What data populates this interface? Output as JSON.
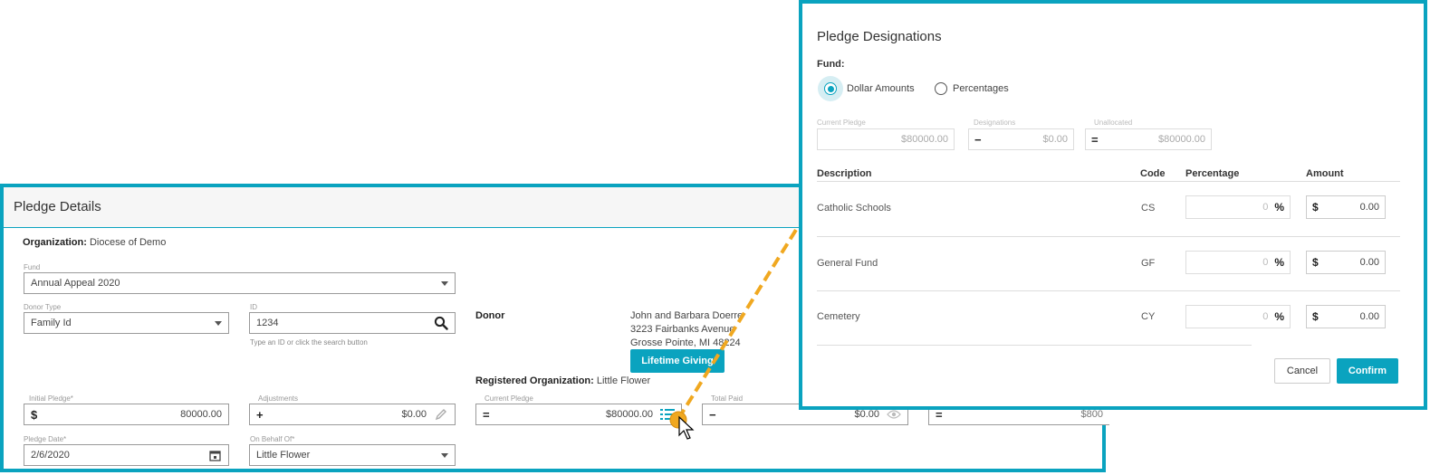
{
  "details": {
    "title": "Pledge Details",
    "organization_label": "Organization:",
    "organization_value": "Diocese of Demo",
    "fund": {
      "label": "Fund",
      "value": "Annual Appeal 2020"
    },
    "donor_type": {
      "label": "Donor Type",
      "value": "Family Id"
    },
    "id_field": {
      "label": "ID",
      "value": "1234",
      "hint": "Type an ID or click the search button"
    },
    "donor": {
      "label": "Donor",
      "name": "John and Barbara Doerre",
      "address1": "3223 Fairbanks Avenue",
      "address2": "Grosse Pointe, MI 48224",
      "lifetime_button": "Lifetime Giving"
    },
    "registered_org_label": "Registered Organization:",
    "registered_org_value": "Little Flower",
    "initial_pledge": {
      "label": "Initial Pledge*",
      "prefix": "$",
      "value": "80000.00"
    },
    "adjustments": {
      "label": "Adjustments",
      "prefix": "+",
      "value": "$0.00"
    },
    "current_pledge": {
      "label": "Current Pledge",
      "prefix": "=",
      "value": "$80000.00"
    },
    "total_paid": {
      "label": "Total Paid",
      "prefix": "−",
      "value": "$0.00"
    },
    "balance": {
      "prefix": "=",
      "value": "$800"
    },
    "pledge_date": {
      "label": "Pledge Date*",
      "value": "2/6/2020"
    },
    "on_behalf_of": {
      "label": "On Behalf Of*",
      "value": "Little Flower"
    }
  },
  "modal": {
    "title": "Pledge Designations",
    "fund_label": "Fund:",
    "options": [
      {
        "label": "Dollar Amounts",
        "selected": true
      },
      {
        "label": "Percentages",
        "selected": false
      }
    ],
    "summary": {
      "current_pledge": {
        "label": "Current Pledge",
        "value": "$80000.00"
      },
      "designations": {
        "label": "Designations",
        "prefix": "−",
        "value": "$0.00"
      },
      "unallocated": {
        "label": "Unallocated",
        "prefix": "=",
        "value": "$80000.00"
      }
    },
    "columns": {
      "description": "Description",
      "code": "Code",
      "percentage": "Percentage",
      "amount": "Amount"
    },
    "rows": [
      {
        "description": "Catholic Schools",
        "code": "CS",
        "percentage": "0",
        "amount": "0.00"
      },
      {
        "description": "General Fund",
        "code": "GF",
        "percentage": "0",
        "amount": "0.00"
      },
      {
        "description": "Cemetery",
        "code": "CY",
        "percentage": "0",
        "amount": "0.00"
      }
    ],
    "pct_suffix": "%",
    "amt_prefix": "$",
    "cancel_label": "Cancel",
    "confirm_label": "Confirm"
  },
  "colors": {
    "accent": "#0aa3bf",
    "annotation": "#f0a820"
  },
  "icons": [
    "search-icon",
    "pencil-icon",
    "list-icon",
    "eye-icon",
    "calendar-icon",
    "chevron-down-icon",
    "mouse-pointer-icon"
  ]
}
